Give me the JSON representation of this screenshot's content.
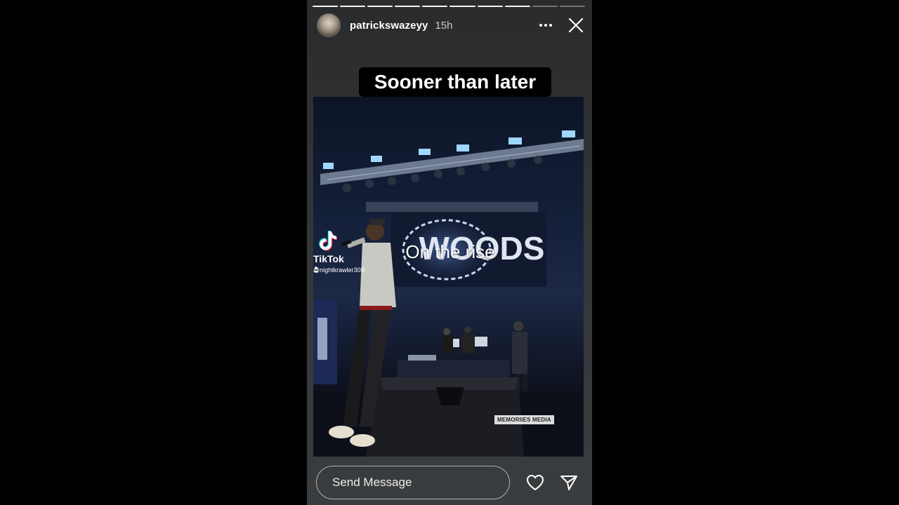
{
  "story": {
    "progress": {
      "total_segments": 10,
      "completed_segments": 8
    },
    "header": {
      "username": "patrickswazeyy",
      "time_ago": "15h",
      "more_icon": "more-horizontal-icon",
      "close_icon": "close-icon"
    },
    "caption_top": "Sooner than later",
    "media": {
      "overlay_text": "On the rise",
      "stage_banner_text": "WOODS",
      "tiktok": {
        "brand": "TikTok",
        "handle": "@nightkrawler30B"
      },
      "watermark": "MEMORIIES MEDIA"
    },
    "footer": {
      "message_placeholder": "Send Message",
      "like_icon": "heart-icon",
      "share_icon": "paper-plane-icon"
    }
  },
  "colors": {
    "page_background": "#000000",
    "story_background": "#323436",
    "text": "#ffffff",
    "stage_light": "#9fd8ff"
  }
}
